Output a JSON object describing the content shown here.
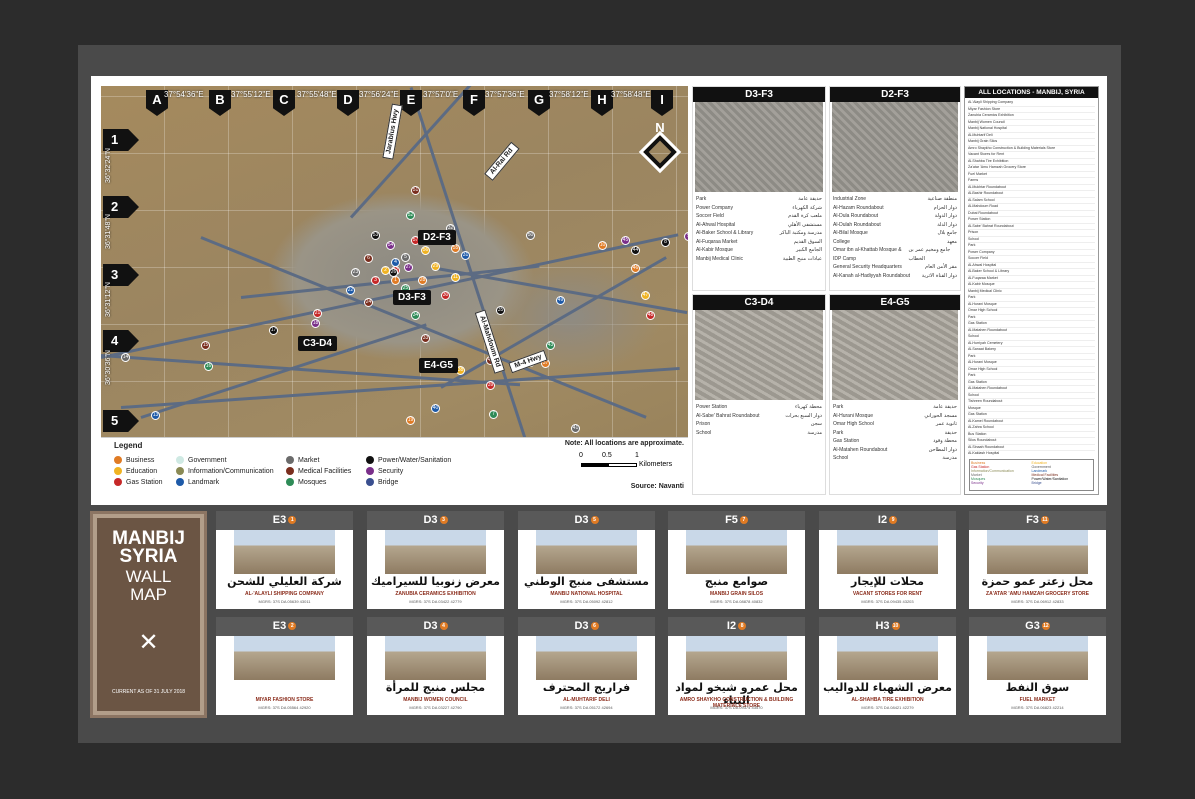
{
  "map": {
    "columns": [
      "A",
      "B",
      "C",
      "D",
      "E",
      "F",
      "G",
      "H",
      "I"
    ],
    "rows": [
      "1",
      "2",
      "3",
      "4",
      "5"
    ],
    "top_coords": [
      "37°54'36\"E",
      "37°55'12\"E",
      "37°55'48\"E",
      "37°56'24\"E",
      "37°57'0\"E",
      "37°57'36\"E",
      "37°58'12\"E",
      "37°58'48\"E"
    ],
    "side_coords": [
      "36°32'24\"N",
      "36°31'48\"N",
      "36°31'12\"N",
      "36°30'36\"N"
    ],
    "areas": [
      "D2-F3",
      "D3-F3",
      "C3-D4",
      "E4-G5"
    ],
    "highways": [
      "Jarablus Hwy",
      "Al-Rai Rd",
      "Al-Mahdoum Rd",
      "M-4 Hwy"
    ],
    "compass": "N",
    "points": [
      "1",
      "2",
      "3",
      "4",
      "5",
      "6",
      "7",
      "8",
      "9",
      "10",
      "11",
      "12",
      "13",
      "14",
      "15",
      "16",
      "17",
      "18",
      "19",
      "20",
      "21",
      "22",
      "23",
      "24",
      "25",
      "26",
      "27",
      "28",
      "29",
      "30",
      "31",
      "32",
      "33",
      "34",
      "35",
      "36",
      "37",
      "38",
      "39",
      "40",
      "41",
      "42",
      "43",
      "44",
      "45",
      "46",
      "47",
      "48",
      "49",
      "50",
      "51",
      "52",
      "53",
      "54",
      "55",
      "56",
      "57"
    ]
  },
  "legend": {
    "title": "Legend",
    "items": [
      {
        "label": "Business",
        "color": "#e07b24"
      },
      {
        "label": "Education",
        "color": "#f0b322"
      },
      {
        "label": "Gas Station",
        "color": "#c62828"
      },
      {
        "label": "Government",
        "color": "#cfe9e3"
      },
      {
        "label": "Information/Communication",
        "color": "#8a8a55"
      },
      {
        "label": "Landmark",
        "color": "#1e5aa8"
      },
      {
        "label": "Market",
        "color": "#6b6b6b"
      },
      {
        "label": "Medical Facilities",
        "color": "#7a2e1e"
      },
      {
        "label": "Mosques",
        "color": "#2e8b57"
      },
      {
        "label": "Power/Water/Sanitation",
        "color": "#111111"
      },
      {
        "label": "Security",
        "color": "#7a2f8a"
      },
      {
        "label": "Bridge",
        "color": "#3a4f8f"
      }
    ],
    "note": "Note: All locations are approximate.",
    "scale": [
      "0",
      "0.5",
      "1"
    ],
    "scale_unit": "Kilometers",
    "source": "Source: Navanti"
  },
  "panels": [
    {
      "title": "D3-F3",
      "rows": [
        {
          "n": "25",
          "en": "Park",
          "ar": "حديقة عامة"
        },
        {
          "n": "26",
          "en": "Power Company",
          "ar": "شركة الكهرباء"
        },
        {
          "n": "27",
          "en": "Soccer Field",
          "ar": "ملعب كرة القدم"
        },
        {
          "n": "28",
          "en": "Al-Ahwal Hospital",
          "ar": "مستشفى الأهلي"
        },
        {
          "n": "29",
          "en": "Al-Baker School & Library",
          "ar": "مدرسة ومكتبة الباكر"
        },
        {
          "n": "30",
          "en": "Al-Fuqaraa Market",
          "ar": "السوق القديم"
        },
        {
          "n": "31",
          "en": "Al-Kabir Mosque",
          "ar": "الجامع الكبير"
        },
        {
          "n": "32",
          "en": "Manbij Medical Clinic",
          "ar": "عيادات منبج الطبية"
        }
      ]
    },
    {
      "title": "D2-F3",
      "rows": [
        {
          "n": "53",
          "en": "Industrial Zone",
          "ar": "منطقة صناعية"
        },
        {
          "n": "54",
          "en": "Al-Hazam Roundabout",
          "ar": "دوار الحزام"
        },
        {
          "n": "55",
          "en": "Al-Dula Roundabout",
          "ar": "دوار الدولة"
        },
        {
          "n": "56",
          "en": "Al-Dulah Roundabout",
          "ar": "دوار الدلة"
        },
        {
          "n": "57",
          "en": "Al-Bilal Mosque",
          "ar": "جامع بلال"
        },
        {
          "n": "58",
          "en": "College",
          "ar": "معهد"
        },
        {
          "n": "59",
          "en": "Omar ibn al-Khattab Mosque & IDP Camp",
          "ar": "جامع ومخيم عمر بن الخطاب"
        },
        {
          "n": "60",
          "en": "General Security Headquarters",
          "ar": "مقر الأمن العام"
        },
        {
          "n": "61",
          "en": "Al-Kanah al-Hadiyyah Roundabout",
          "ar": "دوار القناة الاثرية"
        }
      ]
    },
    {
      "title": "C3-D4",
      "rows": [
        {
          "n": "18",
          "en": "Power Station",
          "ar": "محطة كهرباء"
        },
        {
          "n": "19",
          "en": "Al-Sabe' Bahrat Roundabout",
          "ar": "دوار السبع بحرات"
        },
        {
          "n": "20",
          "en": "Prison",
          "ar": "سجن"
        },
        {
          "n": "21",
          "en": "School",
          "ar": "مدرسة"
        }
      ]
    },
    {
      "title": "E4-G5",
      "rows": [
        {
          "n": "33",
          "en": "Park",
          "ar": "حديقة عامة"
        },
        {
          "n": "34",
          "en": "Al-Hurani Mosque",
          "ar": "مسجد الحوراني"
        },
        {
          "n": "35",
          "en": "Omar High School",
          "ar": "ثانوية عمر"
        },
        {
          "n": "36",
          "en": "Park",
          "ar": "حديقة"
        },
        {
          "n": "37",
          "en": "Gas Station",
          "ar": "محطة وقود"
        },
        {
          "n": "38",
          "en": "Al-Matahen Roundabout",
          "ar": "دوار المطاحن"
        },
        {
          "n": "39",
          "en": "School",
          "ar": "مدرسة"
        }
      ]
    }
  ],
  "all_locations": {
    "title": "ALL LOCATIONS - MANBIJ, SYRIA",
    "items": [
      "Al-'Alayli Shipping Company",
      "Miyar Fashion Store",
      "Zanubia Ceramics Exhibition",
      "Manbij Women Council",
      "Manbij National Hospital",
      "Al-Muhtarif Deli",
      "Manbij Grain Silos",
      "Amro Shaykho Construction & Building Materials Store",
      "Vacant Stores for Rent",
      "Al-Shahba Tire Exhibition",
      "Za'atar 'Amu Hamzah Grocery Store",
      "Fuel Market",
      "Farms",
      "Al-Mukhtar Roundabout",
      "Al-Bashir Roundabout",
      "Al-Salam School",
      "Al-Mahdoum Road",
      "Dubai Roundabout",
      "Power Station",
      "Al-Sabe' Bahrat Roundabout",
      "Prison",
      "School",
      "Park",
      "Power Company",
      "Soccer Field",
      "Al-Ahwal Hospital",
      "Al-Baker School & Library",
      "Al-Fuqaraa Market",
      "Al-Kabir Mosque",
      "Manbij Medical Clinic",
      "Park",
      "Al-Hurani Mosque",
      "Omar High School",
      "Park",
      "Gas Station",
      "Al-Matahen Roundabout",
      "School",
      "Al-Hurriyah Cemetery",
      "Al-Sanaat Bakery",
      "Park",
      "Al-Hurani Mosque",
      "Omar High School",
      "Park",
      "Gas Station",
      "Al-Matahen Roundabout",
      "School",
      "Tishreen Roundabout",
      "Mosque",
      "Gas Station",
      "Al-Kamel Roundabout",
      "Al-Zahra School",
      "Bus Station",
      "Silos Roundabout",
      "Al-Sinaah Roundabout",
      "Al-Kaklash Hospital",
      "Al-Rahman Roundabout",
      "Al-Karam Roundabout",
      "Al-Bassel Roundabout",
      "Industrial Zone",
      "Al-Hazam Roundabout",
      "Al-Dula Roundabout",
      "Al-Dulah Roundabout",
      "Al-Bilal Mosque",
      "College",
      "Omar ibn al-Khattab Mosque & IDP Camp",
      "General Security Headquarters",
      "Al-Kanah al-Hadiyyah Roundabout",
      "Al-Bilal Mosque"
    ],
    "mini_legend": [
      "Business",
      "Education",
      "Gas Station",
      "Government",
      "Information/Communication",
      "Landmark",
      "Market",
      "Medical Facilities",
      "Mosques",
      "Power/Water/Sanitation",
      "Security",
      "Bridge"
    ]
  },
  "cover": {
    "line1": "MANBIJ",
    "line2": "SYRIA",
    "line3": "WALL",
    "line4": "MAP",
    "icon": "✕",
    "date": "CURRENT AS OF 31 JULY 2018"
  },
  "cards": [
    {
      "grid": "E3",
      "num": "1",
      "ar": "شركة العليلي للشحن",
      "en": "AL-'ALAYLI SHIPPING COMPANY",
      "mgrs": "MGRS: 37S DA 05639 43011"
    },
    {
      "grid": "D3",
      "num": "3",
      "ar": "معرض زنوبيا للسيراميك",
      "en": "ZANUBIA CERAMICS EXHIBITION",
      "mgrs": "MGRS: 37S DA 03422 42779"
    },
    {
      "grid": "D3",
      "num": "5",
      "ar": "مستشفى منبج الوطني",
      "en": "MANBIJ NATIONAL HOSPITAL",
      "mgrs": "MGRS: 37S DA 05092 42812"
    },
    {
      "grid": "F5",
      "num": "7",
      "ar": "صوامع منبج",
      "en": "MANBIJ GRAIN SILOS",
      "mgrs": "MGRS: 37S DA 08878 40832"
    },
    {
      "grid": "I2",
      "num": "9",
      "ar": "محلات للإيجار",
      "en": "VACANT STORES FOR RENT",
      "mgrs": "MGRS: 37S DA 09435 43203"
    },
    {
      "grid": "F3",
      "num": "11",
      "ar": "محل زعتر عمو حمزة",
      "en": "ZA'ATAR 'AMU HAMZAH GROCERY STORE",
      "mgrs": "MGRS: 37S DA 06912 42833"
    },
    {
      "grid": "E3",
      "num": "2",
      "ar": "",
      "en": "MIYAR FASHION STORE",
      "mgrs": "MGRS: 37S DA 05564 42920"
    },
    {
      "grid": "D3",
      "num": "4",
      "ar": "مجلس منبج للمرأة",
      "en": "MANBIJ WOMEN COUNCIL",
      "mgrs": "MGRS: 37S DA 03227 42790"
    },
    {
      "grid": "D3",
      "num": "6",
      "ar": "فراريج المحترف",
      "en": "AL-MUHTARIF DELI",
      "mgrs": "MGRS: 37S DA 05172 42694"
    },
    {
      "grid": "I2",
      "num": "8",
      "ar": "محل عمرو شيخو لمواد البناء",
      "en": "AMRO SHAYKHO CONSTRUCTION & BUILDING MATERIALS STORE",
      "mgrs": "MGRS: 37S DA 09374 43570"
    },
    {
      "grid": "H3",
      "num": "10",
      "ar": "معرض الشهباء للدواليب",
      "en": "AL-SHAHBA TIRE EXHIBITION",
      "mgrs": "MGRS: 37S DA 08421 42279"
    },
    {
      "grid": "G3",
      "num": "12",
      "ar": "سوق النفط",
      "en": "FUEL MARKET",
      "mgrs": "MGRS: 37S DA 06823 42214"
    }
  ]
}
